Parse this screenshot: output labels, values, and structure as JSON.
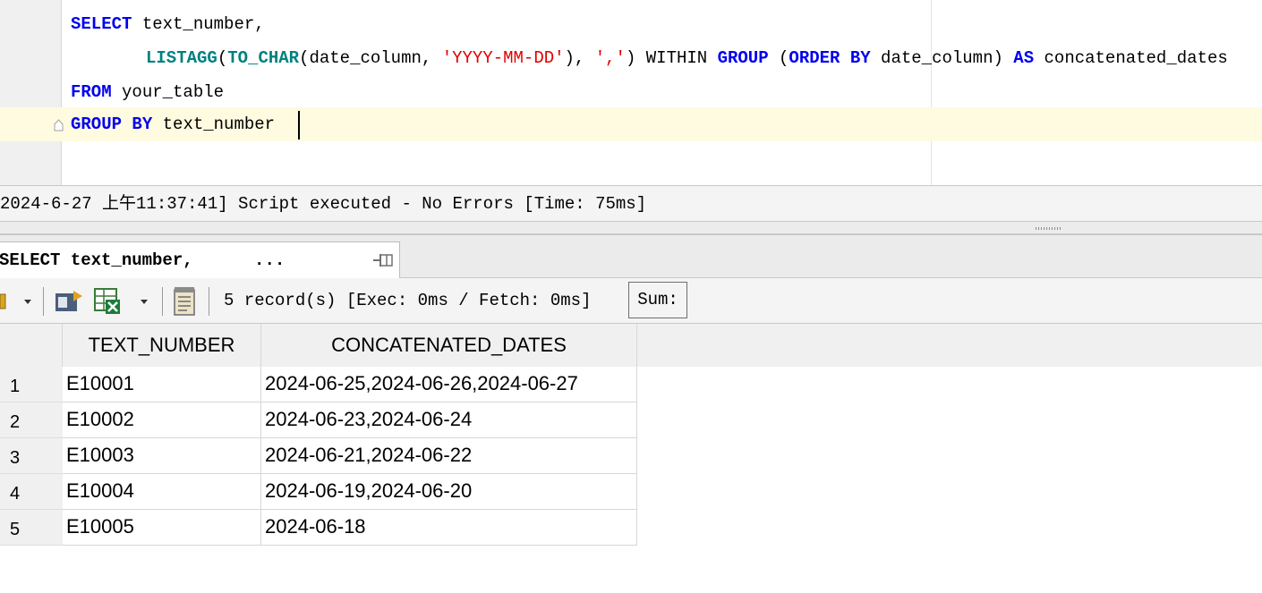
{
  "editor": {
    "line1": {
      "kw1": "SELECT",
      "t1": " text_number,"
    },
    "line2": {
      "fn1": "LISTAGG",
      "t1": "(",
      "fn2": "TO_CHAR",
      "t2": "(date_column, ",
      "s1": "'YYYY-MM-DD'",
      "t3": "), ",
      "s2": "','",
      "t4": ") WITHIN ",
      "kw1": "GROUP",
      "t5": " (",
      "kw2": "ORDER",
      "t6": " ",
      "kw3": "BY",
      "t7": " date_column) ",
      "kw4": "AS",
      "t8": " concatenated_dates"
    },
    "line3": {
      "kw1": "FROM",
      "t1": " your_table"
    },
    "line4": {
      "kw1": "GROUP",
      "t1": " ",
      "kw2": "BY",
      "t2": " text_number"
    }
  },
  "status": {
    "message": "2024-6-27 上午11:37:41] Script executed - No Errors [Time: 75ms]"
  },
  "result_tab": {
    "label": "SELECT text_number,      ..."
  },
  "toolbar": {
    "record_info": "5 record(s) [Exec: 0ms / Fetch: 0ms]",
    "sum_label": "Sum:",
    "icons": [
      "lock-icon",
      "dropdown-arrow-icon",
      "export-icon",
      "excel-icon",
      "dropdown-arrow-icon",
      "notepad-icon"
    ]
  },
  "grid": {
    "columns": [
      "TEXT_NUMBER",
      "CONCATENATED_DATES"
    ],
    "rows": [
      {
        "num": "1",
        "text_number": "E10001",
        "concatenated_dates": "2024-06-25,2024-06-26,2024-06-27"
      },
      {
        "num": "2",
        "text_number": "E10002",
        "concatenated_dates": "2024-06-23,2024-06-24"
      },
      {
        "num": "3",
        "text_number": "E10003",
        "concatenated_dates": "2024-06-21,2024-06-22"
      },
      {
        "num": "4",
        "text_number": "E10004",
        "concatenated_dates": "2024-06-19,2024-06-20"
      },
      {
        "num": "5",
        "text_number": "E10005",
        "concatenated_dates": "2024-06-18"
      }
    ]
  },
  "colors": {
    "keyword": "#0000ee",
    "function": "#008080",
    "string": "#e00000",
    "current_line": "#fefbe0"
  }
}
